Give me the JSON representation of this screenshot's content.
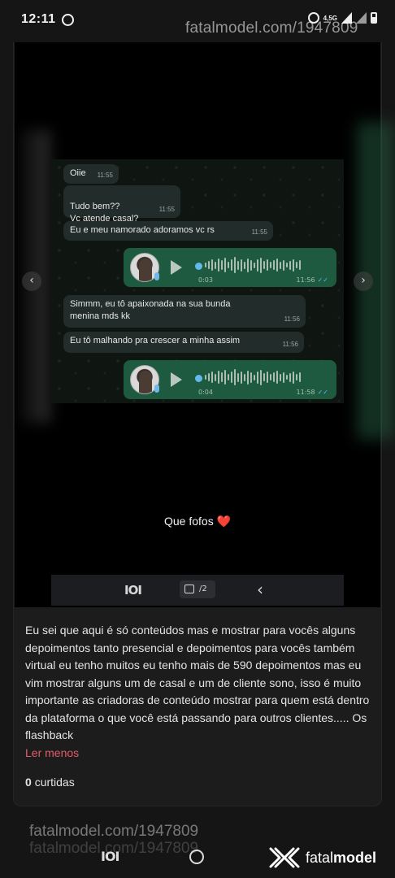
{
  "status_bar": {
    "time": "12:11",
    "network": "4,5G"
  },
  "watermark": {
    "top": "fatalmodel.com/1947809",
    "bottom": "fatalmodel.com/1947809",
    "bottom_shadow": "fatalmodel.com/1947809"
  },
  "chat": {
    "messages": [
      {
        "text": "Oiie",
        "time": "11:55"
      },
      {
        "text": "Tudo bem??\nVc atende casal?",
        "time": "11:55"
      },
      {
        "text": "Eu e meu namorado adoramos vc rs",
        "time": "11:55"
      },
      {
        "text": "Simmm, eu tô apaixonada na sua bunda menina mds kk",
        "time": "11:56"
      },
      {
        "text": "Eu tô malhando pra crescer a minha assim",
        "time": "11:56"
      }
    ],
    "voice_notes": [
      {
        "duration": "0:03",
        "time": "11:56",
        "ticks": "✓✓"
      },
      {
        "duration": "0:04",
        "time": "11:58",
        "ticks": "✓✓"
      }
    ]
  },
  "media": {
    "caption": "Que fofos",
    "caption_emoji": "❤️",
    "prev_icon": "‹",
    "next_icon": "›",
    "counter": "/2",
    "grid_icon": "IOI",
    "back_icon": "‹"
  },
  "post": {
    "description": "Eu sei que aqui é só conteúdos mas e mostrar para vocês alguns depoimentos tanto presencial e depoimentos para vocês também virtual eu tenho muitos eu tenho mais de 590 depoimentos mas eu vim mostrar alguns um de casal e um de cliente sono, isso é muito importante as criadoras de conteúdo mostrar para quem está dentro da plataforma o que você está passando para outros clientes..... Os flashback",
    "read_less": "Ler menos",
    "likes_count": "0",
    "likes_label": "curtidas"
  },
  "brand": {
    "name_light": "fatal",
    "name_bold": "model"
  },
  "nav": {
    "recent_icon": "IOI"
  },
  "colors": {
    "accent": "#e25d6b",
    "voice_bubble": "#1d5a3f",
    "chat_bubble": "#222c2a"
  }
}
